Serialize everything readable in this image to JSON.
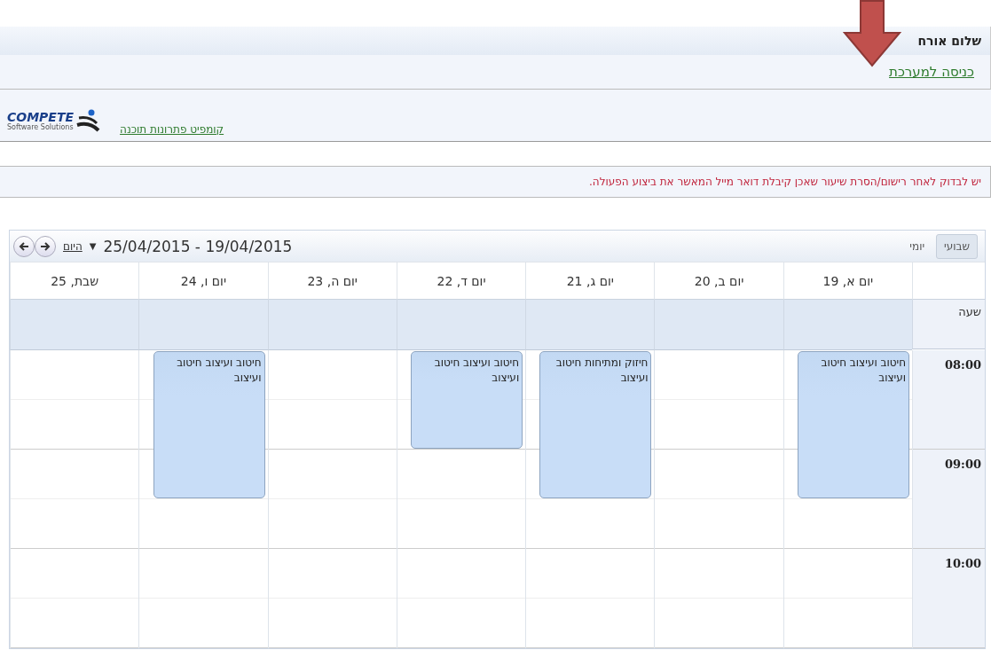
{
  "header": {
    "greeting": "שלום אורח",
    "login_link": "כניסה למערכת"
  },
  "brand": {
    "logo_text": "COMPETE",
    "logo_subtext": "Software Solutions",
    "link": "קומפיט פתרונות תוכנה"
  },
  "notice": "יש לבדוק לאחר רישום/הסרת שיעור שאכן קיבלת דואר מייל המאשר את ביצוע הפעולה.",
  "calendar": {
    "views": [
      {
        "label": "שבועי",
        "selected": true
      },
      {
        "label": "יומי",
        "selected": false
      }
    ],
    "range": "25/04/2015 - 19/04/2015",
    "dropdown": "▼",
    "today_link": "היום",
    "hour_header": "שעה",
    "days": [
      {
        "label": "יום א, 19",
        "events": [
          {
            "title": "חיטוב ועיצוב חיטוב ועיצוב",
            "kind": "long"
          }
        ]
      },
      {
        "label": "יום ב, 20"
      },
      {
        "label": "יום ג, 21",
        "events": [
          {
            "title": "חיזוק ומתיחות חיטוב ועיצוב",
            "kind": "long"
          }
        ]
      },
      {
        "label": "יום ד, 22",
        "events": [
          {
            "title": "חיטוב ועיצוב חיטוב ועיצוב",
            "kind": "short"
          }
        ]
      },
      {
        "label": "יום ה, 23"
      },
      {
        "label": "יום ו, 24",
        "events": [
          {
            "title": "חיטוב ועיצוב חיטוב ועיצוב",
            "kind": "long"
          }
        ]
      },
      {
        "label": "שבת, 25"
      }
    ],
    "hours": [
      "08:00",
      "09:00",
      "10:00"
    ]
  }
}
